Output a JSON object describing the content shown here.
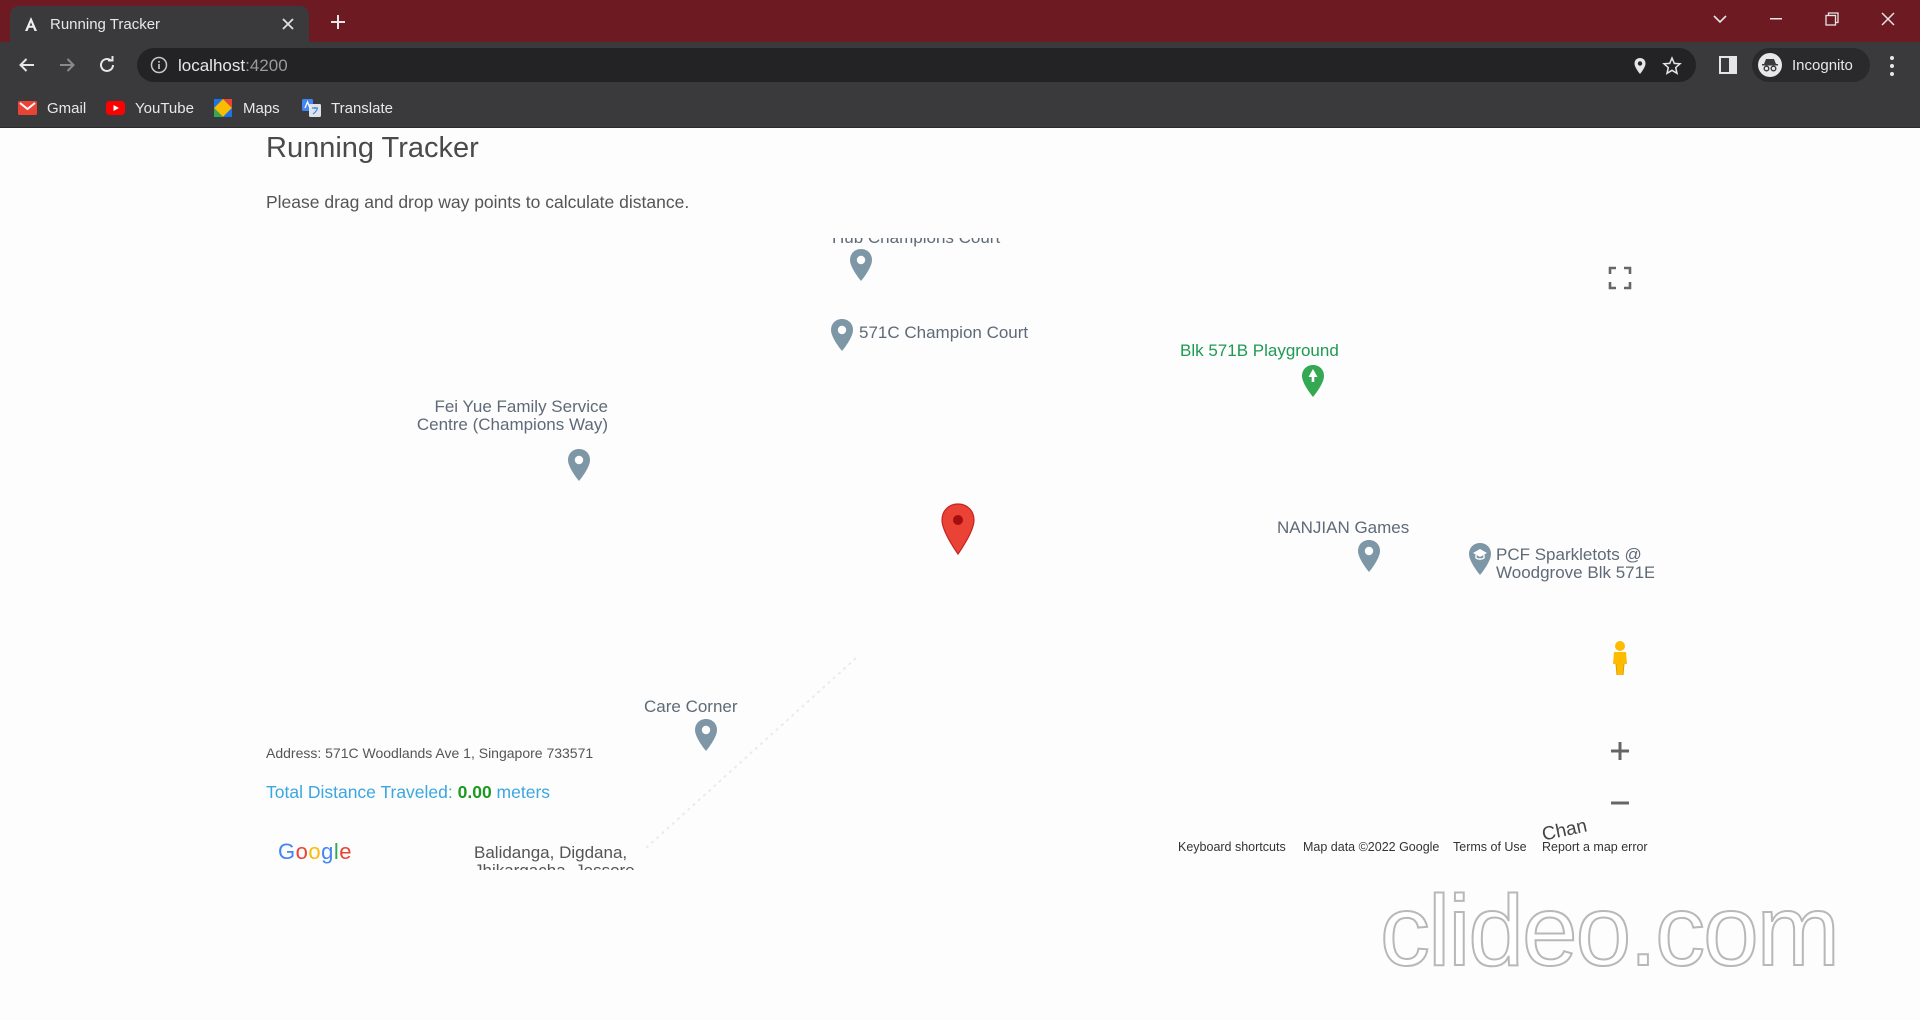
{
  "browser": {
    "tab_title": "Running Tracker",
    "url_host": "localhost",
    "url_port": ":4200",
    "profile_label": "Incognito",
    "bookmarks": [
      {
        "label": "Gmail",
        "icon": "gmail-icon"
      },
      {
        "label": "YouTube",
        "icon": "youtube-icon"
      },
      {
        "label": "Maps",
        "icon": "maps-icon"
      },
      {
        "label": "Translate",
        "icon": "translate-icon"
      }
    ],
    "frame_color": "#6e1a22",
    "toolbar_color": "#3a3a3c"
  },
  "page": {
    "title": "Running Tracker",
    "intro": "Please drag and drop way points to calculate distance."
  },
  "map": {
    "pois": [
      {
        "label": "Hub Champions Court"
      },
      {
        "label": "571C Champion Court"
      },
      {
        "label": "Blk 571B Playground"
      },
      {
        "line1": "Fei Yue Family Service",
        "line2": "Centre (Champions Way)"
      },
      {
        "label": "NANJIAN Games"
      },
      {
        "line1": "PCF Sparkletots @",
        "line2": "Woodgrove Blk 571E"
      },
      {
        "label": "Care Corner"
      },
      {
        "line1": "Balidanga, Digdana,",
        "line2": "Jhikargacha, Jessore"
      },
      {
        "label": "Chan"
      }
    ],
    "attribution": {
      "keyboard": "Keyboard shortcuts",
      "data": "Map data ©2022 Google",
      "terms": "Terms of Use",
      "report": "Report a map error"
    },
    "logo": "Google",
    "marker_color": "#ea4335",
    "poi_color": "#7e97a6",
    "park_color": "#34a853"
  },
  "footer": {
    "address": "Address: 571C Woodlands Ave 1, Singapore 733571",
    "distance_label": "Total Distance Traveled: ",
    "distance_value": "0.00",
    "distance_unit": " meters"
  },
  "watermark": "clideo.com"
}
